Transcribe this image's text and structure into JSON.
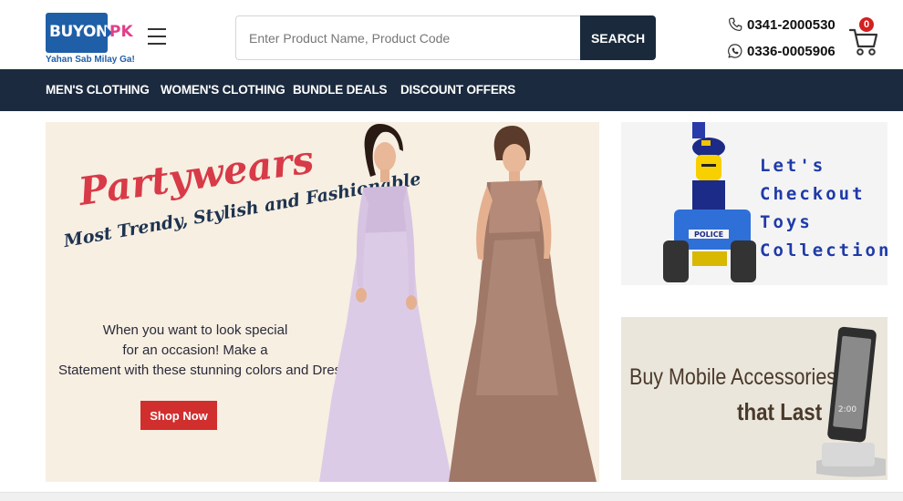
{
  "brand": {
    "name": "BUYON",
    "suffix": "PK",
    "tagline": "Yahan Sab Milay Ga!"
  },
  "search": {
    "placeholder": "Enter Product Name, Product Code",
    "value": "",
    "button_label": "SEARCH"
  },
  "contact": {
    "phone": "0341-2000530",
    "whatsapp": "0336-0005906"
  },
  "cart": {
    "count": "0"
  },
  "nav": {
    "items": [
      {
        "label": "MEN'S CLOTHING"
      },
      {
        "label": "WOMEN'S CLOTHING"
      },
      {
        "label": "BUNDLE DEALS"
      },
      {
        "label": "DISCOUNT OFFERS"
      }
    ]
  },
  "hero": {
    "title": "Partywears",
    "subtitle": "Most Trendy, Stylish and Fashionable",
    "body_lines": [
      "When you want to look special",
      "for an occasion! Make a",
      "Statement with these stunning colors and Dresses !"
    ],
    "cta_label": "Shop Now"
  },
  "toys_banner": {
    "lines": [
      "Let's",
      "Checkout",
      "Toys",
      "Collection"
    ],
    "toy_label": "POLICE"
  },
  "mobile_banner": {
    "line1": "Buy Mobile Accessories",
    "line2": "that Last",
    "phone_clock": "2:00"
  },
  "colors": {
    "navy": "#1b2a3e",
    "brand_blue": "#1f5fa8",
    "brand_pink": "#e0408a",
    "cta_red": "#d12e2e",
    "hero_title_red": "#d83a48",
    "toys_blue": "#1f3aa8"
  },
  "icons": {
    "menu": "hamburger-icon",
    "phone": "phone-icon",
    "whatsapp": "whatsapp-icon",
    "cart": "cart-icon"
  }
}
